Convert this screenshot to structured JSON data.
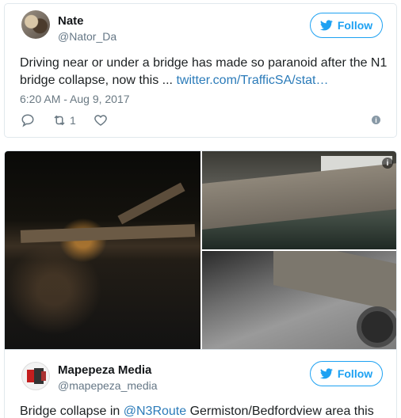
{
  "tweet1": {
    "name": "Nate",
    "handle": "@Nator_Da",
    "follow_label": "Follow",
    "text": "Driving near or under a bridge has made so paranoid after the N1 bridge collapse, now this ... ",
    "link": "twitter.com/TrafficSA/stat…",
    "time": "6:20 AM - Aug 9, 2017",
    "retweet_count": "1",
    "icons": {
      "reply": "reply-icon",
      "retweet": "retweet-icon",
      "like": "heart-icon",
      "info": "info-icon"
    }
  },
  "tweet2": {
    "name": "Mapepeza Media",
    "handle": "@mapepeza_media",
    "follow_label": "Follow",
    "text_before": "Bridge collapse in ",
    "mention": "@N3Route",
    "text_after": " Germiston/Bedfordview area this"
  },
  "colors": {
    "accent": "#1da1f2",
    "link": "#2b7bb9",
    "muted": "#657786"
  }
}
